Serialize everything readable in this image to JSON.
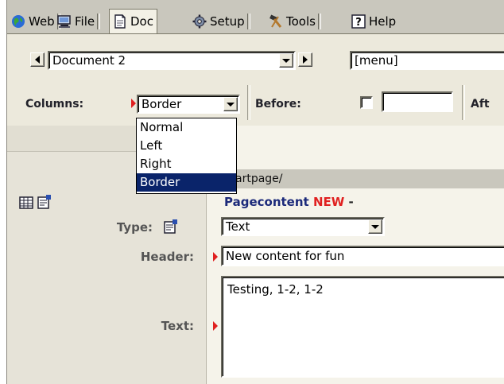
{
  "tabs": [
    {
      "label": "Web",
      "icon": "globe-icon"
    },
    {
      "label": "File",
      "icon": "computer-icon"
    },
    {
      "label": "Doc",
      "icon": "document-icon"
    },
    {
      "label": "Setup",
      "icon": "gear-icon"
    },
    {
      "label": "Tools",
      "icon": "hammer-icon"
    },
    {
      "label": "Help",
      "icon": "help-icon"
    }
  ],
  "active_tab": "Doc",
  "toolbar": {
    "document_select": "Document 2",
    "menu_select": "[menu]",
    "columns_label": "Columns:",
    "columns_value": "Border",
    "before_label": "Before:",
    "after_label": "Aft"
  },
  "columns_dropdown": {
    "options": [
      "Normal",
      "Left",
      "Right",
      "Border"
    ],
    "selected": "Border"
  },
  "content": {
    "path": "artpage/",
    "pagecontent": "Pagecontent",
    "new_badge": "NEW",
    "dash": "-",
    "type_label": "Type:",
    "type_value": "Text",
    "header_label": "Header:",
    "header_value": "New content for fun",
    "text_label": "Text:",
    "text_value": "Testing, 1-2, 1-2"
  },
  "colors": {
    "tabbar": "#c9c7bd",
    "panel": "#ece9dc",
    "selection": "#0a246a",
    "required_marker": "#e02020",
    "pagecontent_title": "#1c2a7a"
  }
}
